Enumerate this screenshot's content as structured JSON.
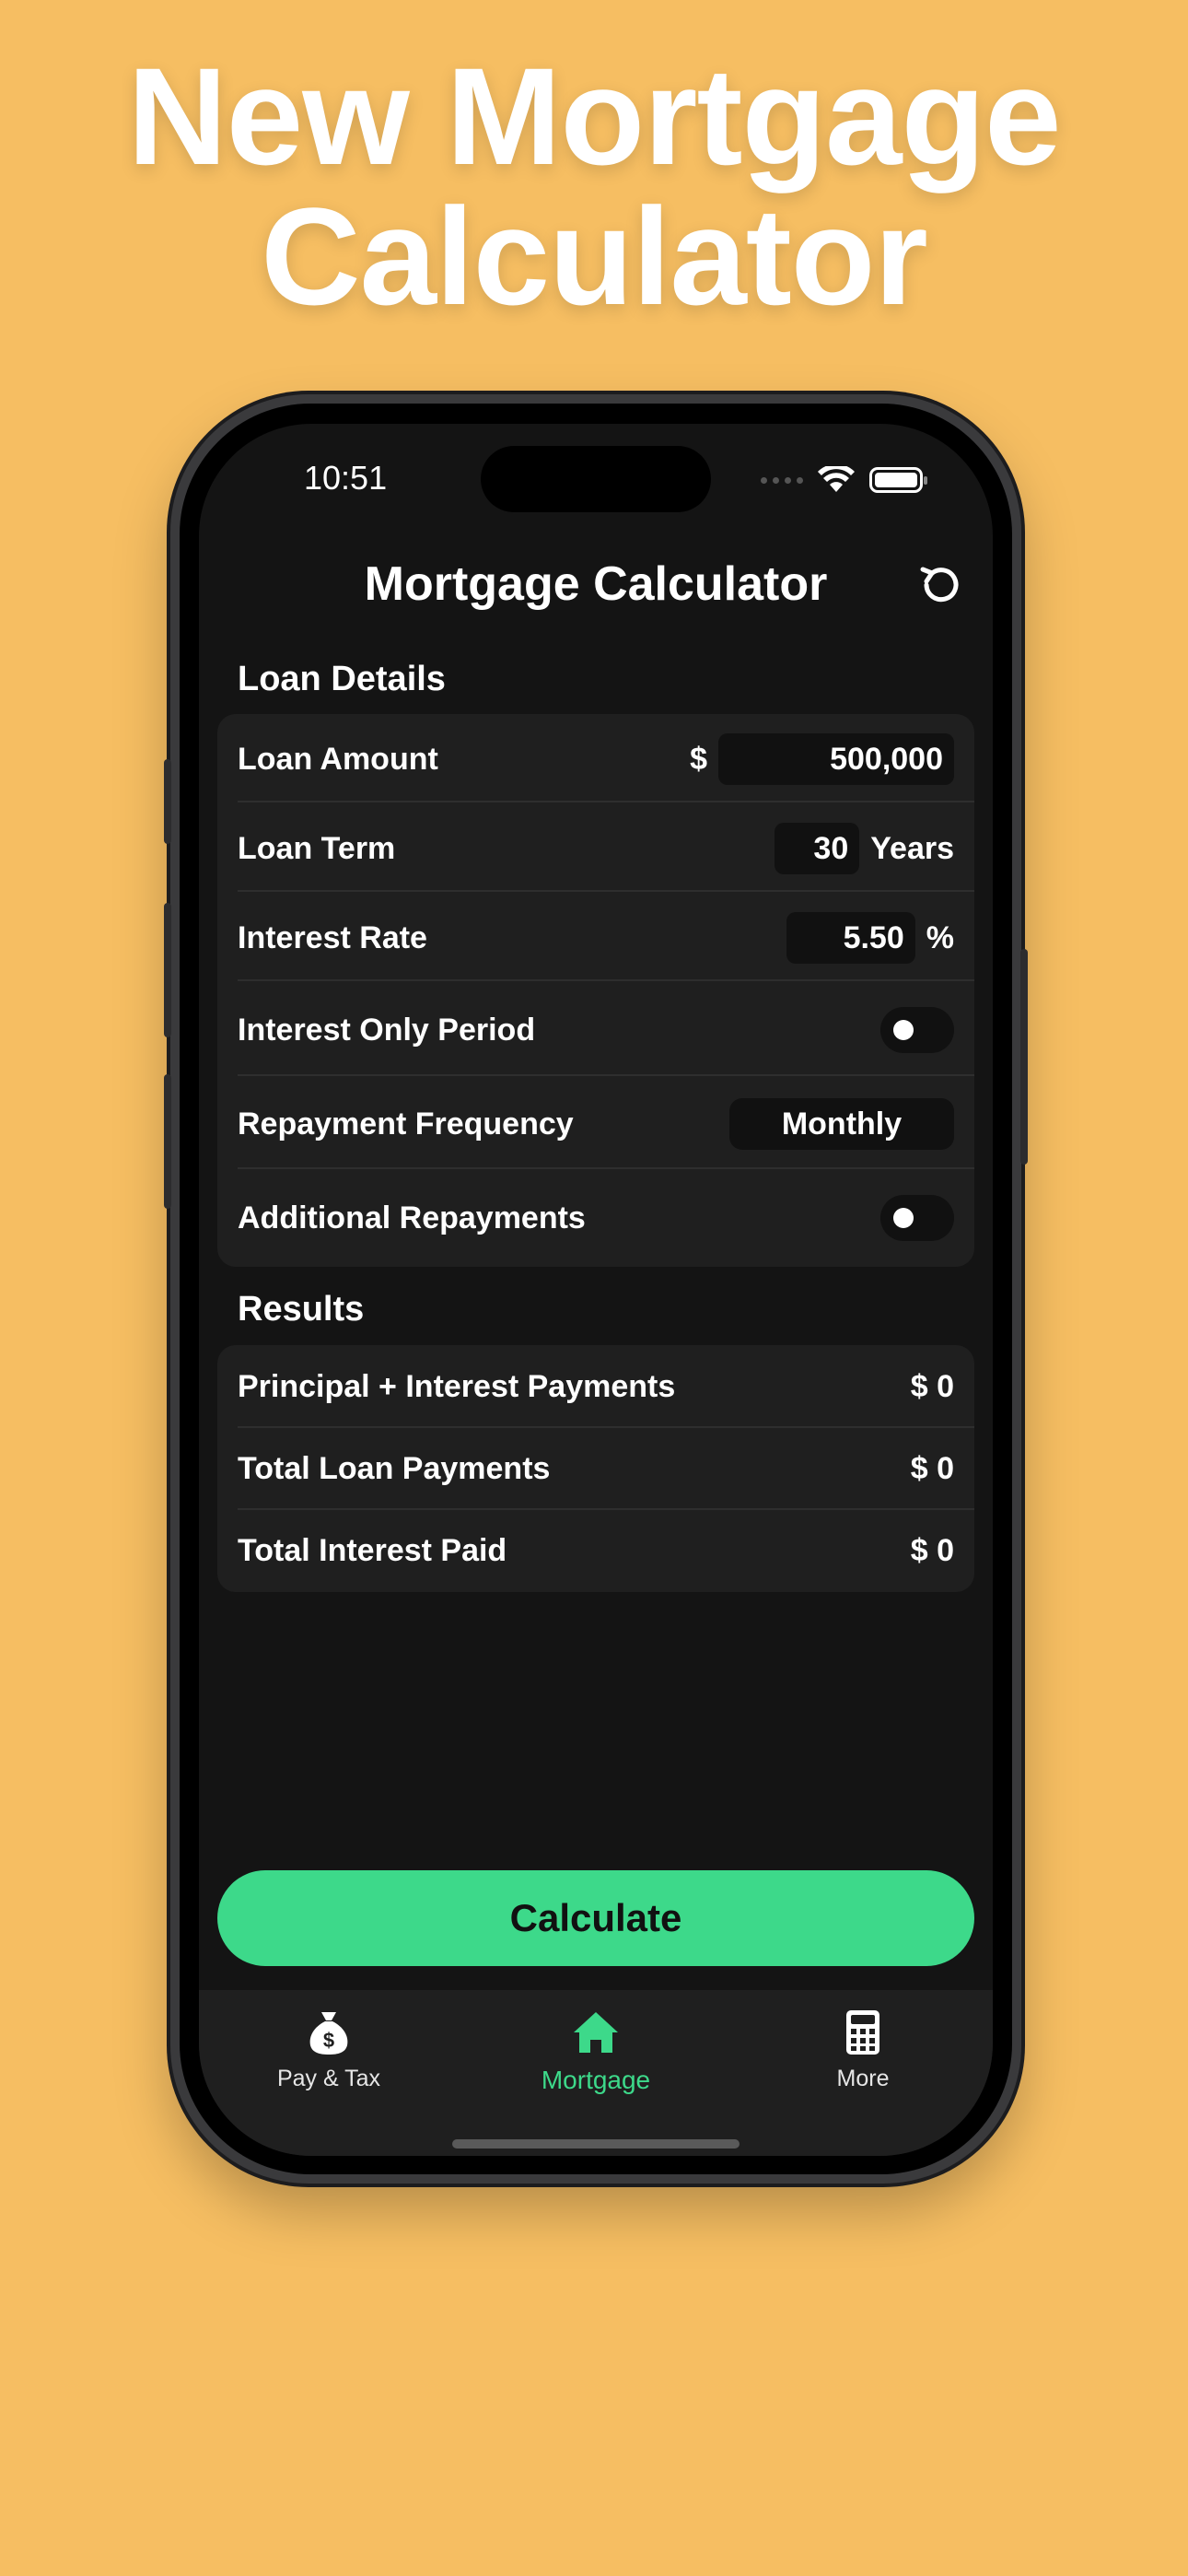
{
  "headline": {
    "line1": "New Mortgage",
    "line2": "Calculator"
  },
  "status_bar": {
    "time": "10:51"
  },
  "nav": {
    "title": "Mortgage Calculator",
    "reset_icon": "reset-icon"
  },
  "loan_details": {
    "title": "Loan Details",
    "loan_amount": {
      "label": "Loan Amount",
      "currency": "$",
      "value": "500,000"
    },
    "loan_term": {
      "label": "Loan Term",
      "value": "30",
      "unit": "Years"
    },
    "interest_rate": {
      "label": "Interest Rate",
      "value": "5.50",
      "unit": "%"
    },
    "interest_only": {
      "label": "Interest Only Period",
      "on": false
    },
    "repayment_frequency": {
      "label": "Repayment Frequency",
      "value": "Monthly"
    },
    "additional_repayments": {
      "label": "Additional Repayments",
      "on": false
    }
  },
  "results": {
    "title": "Results",
    "rows": [
      {
        "label": "Principal + Interest Payments",
        "value": "$ 0"
      },
      {
        "label": "Total Loan Payments",
        "value": "$ 0"
      },
      {
        "label": "Total Interest Paid",
        "value": "$ 0"
      }
    ]
  },
  "calculate_label": "Calculate",
  "tabs": [
    {
      "label": "Pay & Tax",
      "icon": "money-bag-icon",
      "active": false
    },
    {
      "label": "Mortgage",
      "icon": "house-icon",
      "active": true
    },
    {
      "label": "More",
      "icon": "calculator-icon",
      "active": false
    }
  ],
  "colors": {
    "background": "#F6BE62",
    "accent": "#3DD98A",
    "screen": "#141414",
    "card": "#1F1F1F"
  }
}
